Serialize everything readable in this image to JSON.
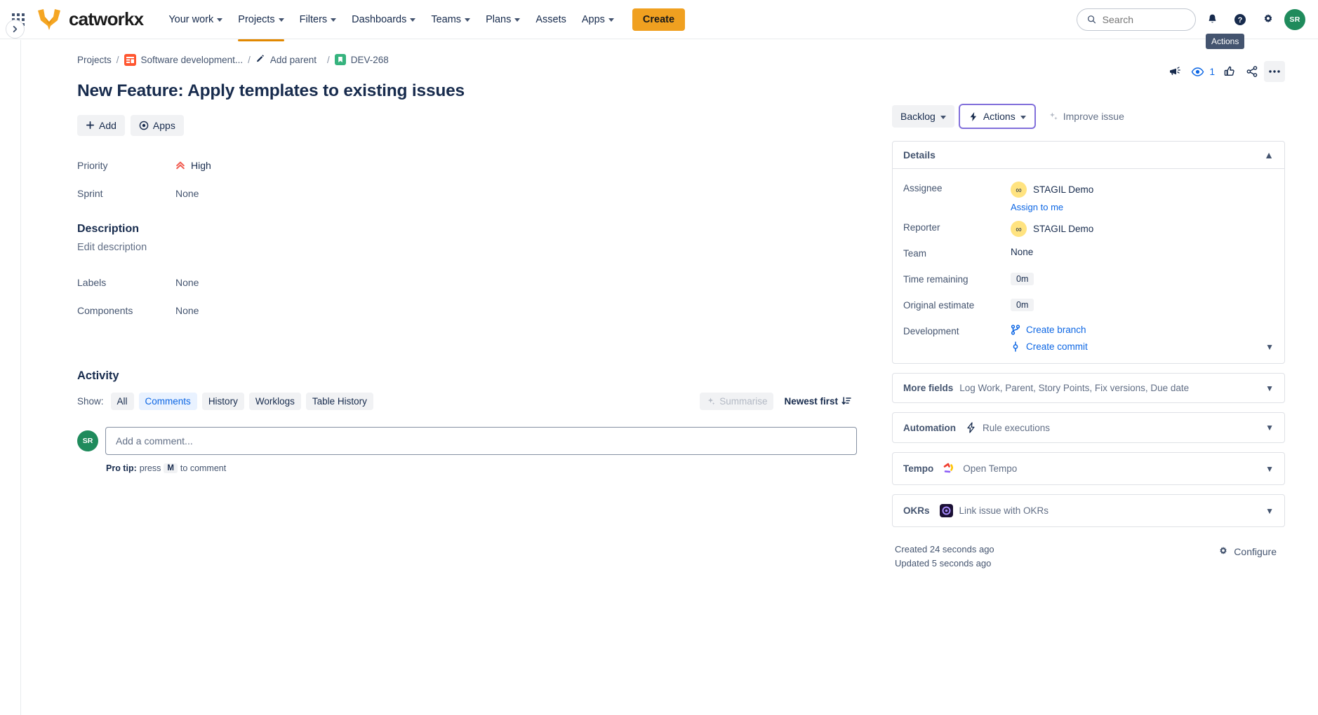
{
  "nav": {
    "brand": "catworkx",
    "apps_icon": "app-grid-icon",
    "items": [
      {
        "label": "Your work",
        "caret": true,
        "active": false
      },
      {
        "label": "Projects",
        "caret": true,
        "active": true
      },
      {
        "label": "Filters",
        "caret": true,
        "active": false
      },
      {
        "label": "Dashboards",
        "caret": true,
        "active": false
      },
      {
        "label": "Teams",
        "caret": true,
        "active": false
      },
      {
        "label": "Plans",
        "caret": true,
        "active": false
      },
      {
        "label": "Assets",
        "caret": false,
        "active": false
      },
      {
        "label": "Apps",
        "caret": true,
        "active": false
      }
    ],
    "create_label": "Create",
    "search_placeholder": "Search",
    "avatar_initials": "SR",
    "tooltip": "Actions",
    "accent_orange": "#E28800",
    "create_bg": "#F0A020"
  },
  "breadcrumb": {
    "projects": "Projects",
    "project": "Software development...",
    "add_parent": "Add parent",
    "issue_key": "DEV-268",
    "separator": "/"
  },
  "issue": {
    "title": "New Feature: Apply templates to existing issues",
    "add_label": "Add",
    "apps_label": "Apps",
    "fields": [
      {
        "label": "Priority",
        "value": "High",
        "icon": "priority-high-icon"
      },
      {
        "label": "Sprint",
        "value": "None",
        "icon": ""
      },
      {
        "label": "Labels",
        "value": "None",
        "icon": ""
      },
      {
        "label": "Components",
        "value": "None",
        "icon": ""
      }
    ],
    "description_heading": "Description",
    "description_placeholder": "Edit description"
  },
  "activity": {
    "heading": "Activity",
    "show_label": "Show:",
    "tabs": [
      {
        "label": "All",
        "selected": false
      },
      {
        "label": "Comments",
        "selected": true
      },
      {
        "label": "History",
        "selected": false
      },
      {
        "label": "Worklogs",
        "selected": false
      },
      {
        "label": "Table History",
        "selected": false
      }
    ],
    "summarise_label": "Summarise",
    "sort_label": "Newest first",
    "comment_placeholder": "Add a comment...",
    "avatar_initials": "SR",
    "protip_prefix": "Pro tip:",
    "protip_mid": "press",
    "protip_key": "M",
    "protip_suffix": "to comment"
  },
  "toolbar": {
    "status_label": "Backlog",
    "actions_label": "Actions",
    "improve_label": "Improve issue",
    "watch_count": "1",
    "icons": [
      "feedback-megaphone-icon",
      "watch-eye-icon",
      "vote-thumbs-up-icon",
      "share-icon",
      "more-options-icon"
    ]
  },
  "details": {
    "heading": "Details",
    "rows": [
      {
        "label": "Assignee",
        "value": "STAGIL Demo",
        "type": "user",
        "sub": "Assign to me"
      },
      {
        "label": "Reporter",
        "value": "STAGIL Demo",
        "type": "user",
        "sub": ""
      },
      {
        "label": "Team",
        "value": "None",
        "type": "text",
        "sub": ""
      },
      {
        "label": "Time remaining",
        "value": "0m",
        "type": "pill",
        "sub": ""
      },
      {
        "label": "Original estimate",
        "value": "0m",
        "type": "pill",
        "sub": ""
      }
    ],
    "development_label": "Development",
    "create_branch": "Create branch",
    "create_commit": "Create commit"
  },
  "sections": [
    {
      "title": "More fields",
      "subtitle": "Log Work, Parent, Story Points, Fix versions, Due date",
      "icon": ""
    },
    {
      "title": "Automation",
      "subtitle": "Rule executions",
      "icon": "automation-bolt-icon"
    },
    {
      "title": "Tempo",
      "subtitle": "Open Tempo",
      "icon": "tempo-logo-icon"
    },
    {
      "title": "OKRs",
      "subtitle": "Link issue with OKRs",
      "icon": "okr-target-icon"
    }
  ],
  "footer": {
    "created": "Created 24 seconds ago",
    "updated": "Updated 5 seconds ago",
    "configure": "Configure"
  }
}
